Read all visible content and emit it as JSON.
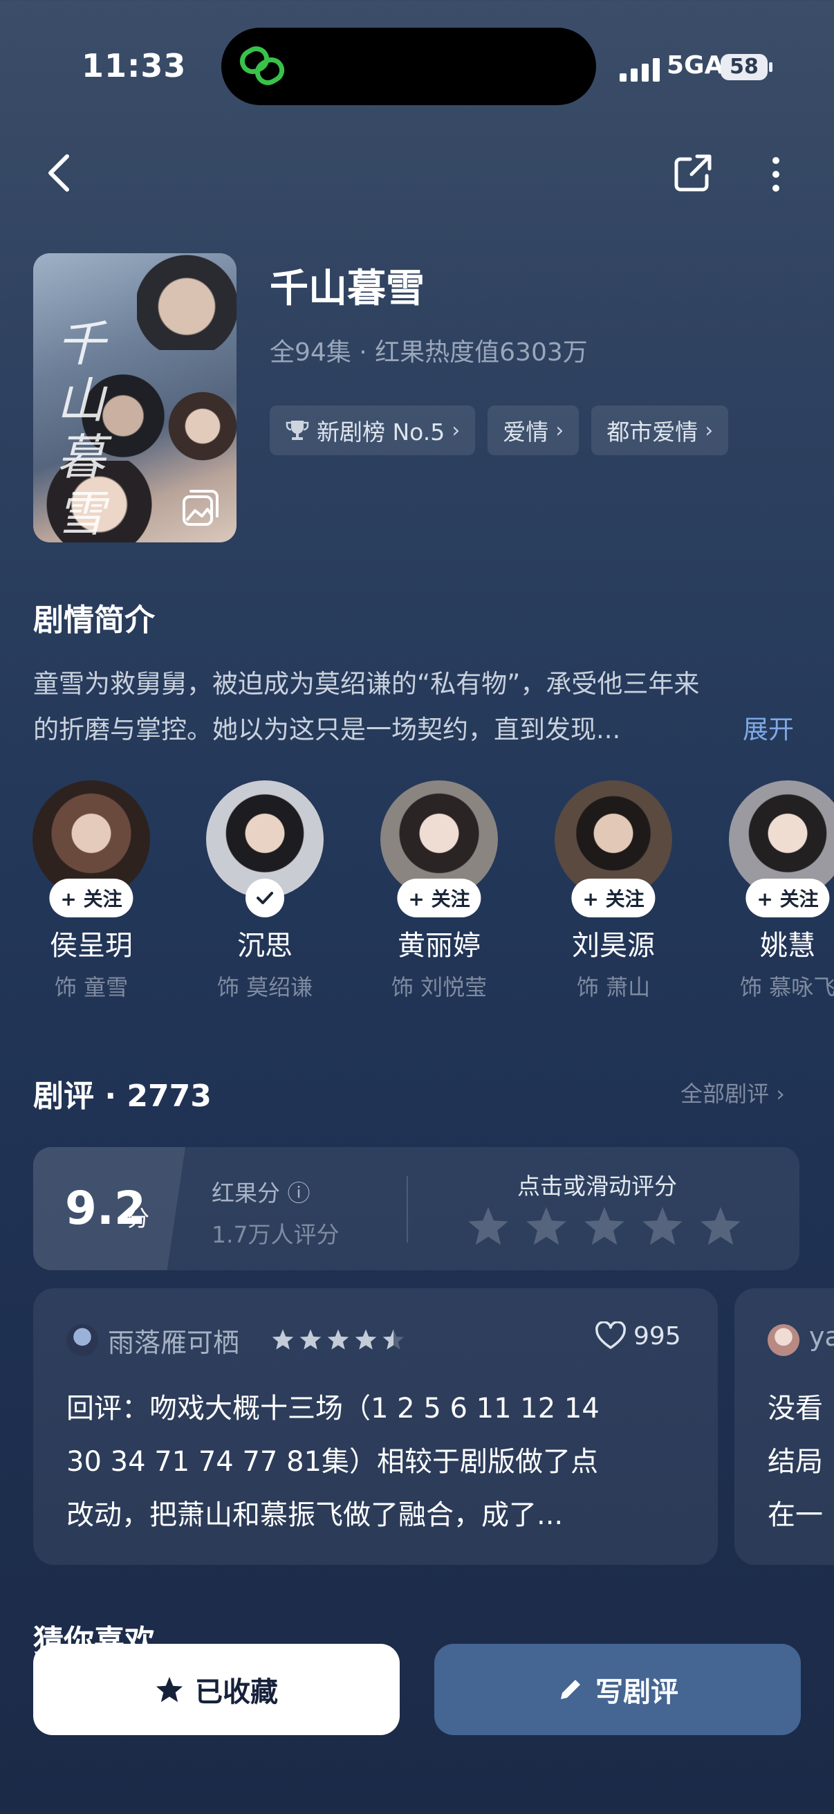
{
  "status_bar": {
    "time": "11:33",
    "network": "5GA",
    "battery": "58"
  },
  "nav": {
    "back_icon": "chevron-left-icon",
    "share_icon": "share-icon",
    "more_icon": "more-vertical-icon"
  },
  "drama": {
    "title": "千山暮雪",
    "meta": "全94集 · 红果热度值6303万",
    "poster_title": "千山暮雪",
    "tags": [
      {
        "icon": "trophy-icon",
        "label": "新剧榜 No.5"
      },
      {
        "label": "爱情"
      },
      {
        "label": "都市爱情"
      }
    ]
  },
  "synopsis": {
    "heading": "剧情简介",
    "line1": "童雪为救舅舅，被迫成为莫绍谦的“私有物”，承受他三年来",
    "line2": "的折磨与掌控。她以为这只是一场契约，直到发现...",
    "expand": "展开"
  },
  "cast": {
    "follow_label": "+ 关注",
    "members": [
      {
        "name": "侯呈玥",
        "role": "饰 童雪",
        "followed": false,
        "color": "#6b4a3e"
      },
      {
        "name": "沉思",
        "role": "饰 莫绍谦",
        "followed": true,
        "color": "#c9ccd2"
      },
      {
        "name": "黄丽婷",
        "role": "饰 刘悦莹",
        "followed": false,
        "color": "#8a8580"
      },
      {
        "name": "刘昊源",
        "role": "饰 萧山",
        "followed": false,
        "color": "#5a4a40"
      },
      {
        "name": "姚慧",
        "role": "饰 慕咏飞",
        "followed": false,
        "color": "#9a9aa0"
      }
    ]
  },
  "reviews": {
    "heading": "剧评 · 2773",
    "all_label": "全部剧评 ›",
    "score": "9.2",
    "score_unit": "分",
    "hongguo_label": "红果分 ⓘ",
    "rating_count": "1.7万人评分",
    "tap_label": "点击或滑动评分",
    "cards": [
      {
        "user": "雨落雁可栖",
        "stars": 4.5,
        "likes": "995",
        "line1": "回评：吻戏大概十三场（1 2 5 6 11 12 14",
        "line2": "30 34 71 74 77 81集）相较于剧版做了点",
        "line3": "改动，把萧山和慕振飞做了融合，成了..."
      },
      {
        "user": "ya",
        "line1": "没看",
        "line2": "结局",
        "line3": "在一"
      }
    ]
  },
  "guess": {
    "heading": "猜你喜欢"
  },
  "bottom": {
    "collect_label": "已收藏",
    "review_label": "写剧评"
  },
  "colors": {
    "accent": "#7fa9e6",
    "button_blue": "#456592"
  }
}
